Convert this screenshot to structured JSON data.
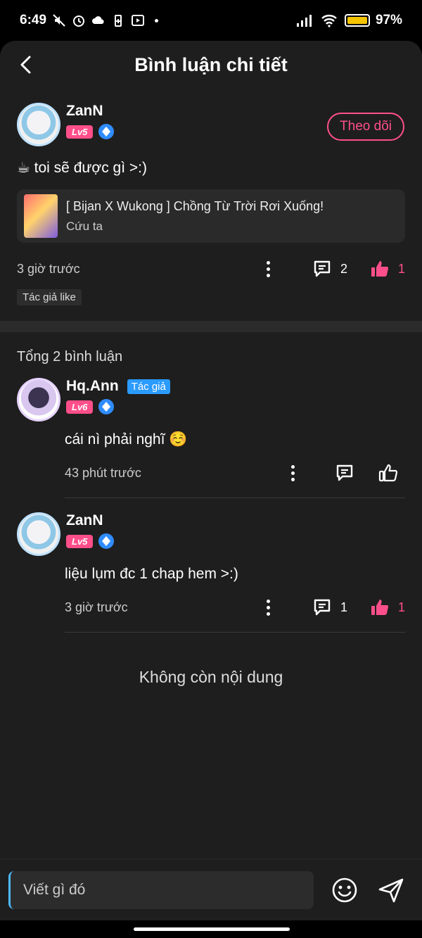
{
  "status_bar": {
    "time": "6:49",
    "battery": "97%"
  },
  "header": {
    "title": "Bình luận chi tiết"
  },
  "root_comment": {
    "username": "ZanN",
    "level": "Lv5",
    "follow_label": "Theo dõi",
    "text": "☕ toi sẽ được gì >:)",
    "story": {
      "title": "[ Bijan X Wukong ] Chồng Từ Trời Rơi Xuống!",
      "chapter": "Cứu ta"
    },
    "time": "3 giờ trước",
    "reply_count": "2",
    "like_count": "1",
    "author_like_tag": "Tác giả like"
  },
  "total_label": "Tổng 2 bình luận",
  "replies": [
    {
      "username": "Hq.Ann",
      "author_tag": "Tác giả",
      "level": "Lv6",
      "text": "cái nì phải nghĩ ☺️",
      "time": "43 phút trước"
    },
    {
      "username": "ZanN",
      "level": "Lv5",
      "text": "liệu lụm đc 1 chap hem >:)",
      "time": "3 giờ trước",
      "reply_count": "1",
      "like_count": "1"
    }
  ],
  "no_more_label": "Không còn nội dung",
  "input": {
    "placeholder": "Viết gì đó"
  },
  "colors": {
    "accent_pink": "#ff4f8b",
    "author_blue": "#2b9bff",
    "bg": "#1e1e1e"
  }
}
